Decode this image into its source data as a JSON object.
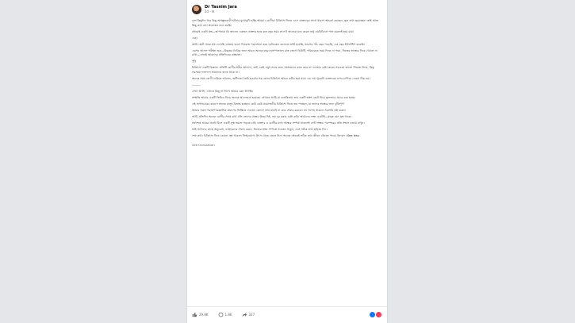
{
  "post": {
    "author": "Dr Tasnim Jara",
    "meta": "2d · ⚙",
    "paragraphs": [
      "বেশ কিছুদিন ধরে কিছু অপ্রস্তুতকারী ঘটনার মুখোমুখি হচ্ছি আমরা। রোগীরা চিকিৎসা নিতে এসে ডাক্তারের সাথে খারাপ আচরণ করছেন, ভুল তথ্য ছড়াচ্ছেন। তাই আজ কিছু কথা বলা প্রয়োজন মনে করছি।",
      "প্রথমেই একটা প্রশ্ন—আপনারা কি জানেন একজন ডাক্তার হতে কত বছর সময় লাগে? অনেকে মনে করেন শুধু এমবিবিএস পাস করলেই হয়ে যায়।",
      "এক)",
      "আমি ছোট থেকে স্বপ্ন দেখেছি ডাক্তার হবো। দিনরাত পড়াশোনা করে মেডিকেল কলেজে ভর্তি হয়েছি, তারপর পাঁচ বছর পড়েছি, এক বছর ইন্টার্নশিপ করেছি।",
      "এরপর আসল পরীক্ষা শুরু—উচ্চতর ডিগ্রির জন্য আরও অনেক বছর। হাসপাতালে রাত জেগে ডিউটি, পরিবারকে সময় দিতে না পারা, নিজের স্বাস্থ্যের দিকে খেয়াল না রাখা—এসবই আমাদের প্রতিদিনের বাস্তবতা।",
      "দুই)",
      "চিকিৎসা একটি বিজ্ঞান। প্রতিটি রোগীর শরীর আলাদা, তাই একই ওষুধ সবার জন্য সমানভাবে কাজ করে না। ডাক্তার চেষ্টা করেন সবচেয়ে ভালো সিদ্ধান্ত নিতে, কিন্তু সবসময় ফলাফল আমাদের হাতে থাকে না।",
      "অনেক সময় রোগী দেরিতে আসেন, জটিলতা তৈরি হওয়ার পর। তখন চিকিৎসা আরও কঠিন হয়ে যায়। এর দায় পুরোটা ডাক্তারের ওপর চাপিয়ে দেওয়া ঠিক নয়।",
      "———",
      "এখন আসি, এখানে কিছু না লিখে আমার কেন লিখছি।",
      "সম্প্রতি আমার একটি ভিডিও নিয়ে অনেক আলোচনা হয়েছে। সেখানে আমি যা বলেছিলাম তার একটি অংশ কেটে নিয়ে ভুলভাবে প্রচার করা হচ্ছে।",
      "এই অপপ্রচারের কারণে অনেক মানুষ বিভ্রান্ত হচ্ছেন। কেউ কেউ প্রয়োজনীয় চিকিৎসা নিতে ভয় পাচ্ছেন, যা তাদের স্বাস্থ্যের জন্য ঝুঁকিপূর্ণ।",
      "আমার সকল পরামর্শ বৈজ্ঞানিক প্রমাণের ভিত্তিতে দেওয়া। কোনো তথ্য যাচাই না করে শেয়ার করবেন না। সন্দেহ থাকলে সরাসরি প্রশ্ন করুন।",
      "আমি প্রতিদিন অনেক রোগীর সাথে কথা বলি। তাদের প্রশ্নের উত্তর দিই, ভয় দূর করার চেষ্টা করি। আমাদের লক্ষ্য একটাই—মানুষ যেন সুস্থ থাকে।",
      "সর্বশেষে আমরা সবাই মিলে একটি সুস্থ সমাজ গড়তে চাই। ডাক্তার ও রোগীর মধ্যে আস্থার সম্পর্ক থাকলেই সেটা সম্ভব। পরস্পরের প্রতি সম্মান বজায় রাখুন।",
      "তাই আপনার কাছে অনুরোধ, ডাক্তারদের সম্মান করুন, নিজের স্বাস্থ্য সম্পর্কে সচেতন থাকুন, এবং সঠিক তথ্য ছড়িয়ে দিন।",
      "শেষ কথা: চিকিৎসা নিয়ে কোনো প্রশ্ন থাকলে নির্ভরযোগ্য উৎস থেকে জেনে নিন। অনেক ক্ষেত্রেই সঠিক তথ্য জীবন বাঁচাতে পারে। ধন্যবাদ। See less"
    ],
    "see_translation": "See translation",
    "reactions_count": "29.8K",
    "comments_count": "1.8K",
    "shares_count": "327"
  }
}
